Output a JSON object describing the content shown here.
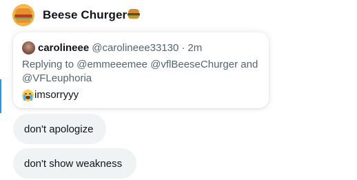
{
  "header": {
    "display_name": "Beese Churger",
    "avatar_icon": "burger-avatar-icon",
    "name_emoji": "hamburger-emoji-icon"
  },
  "quoted_tweet": {
    "author_name": "carolineee",
    "handle": "@carolineee33130",
    "separator": "·",
    "time": "2m",
    "reply_line": "Replying to @emmeeemee @vflBeeseChurger and @VFLeuphoria",
    "text_emoji": "loudly-crying-face-emoji-icon",
    "text": "imsorryyy"
  },
  "messages": [
    {
      "text": "don't apologize"
    },
    {
      "text": "don't show weakness"
    }
  ],
  "colors": {
    "accent": "#1d9bf0",
    "bubble_bg": "#eff3f4",
    "secondary_text": "#536471",
    "primary_text": "#0f1419"
  }
}
